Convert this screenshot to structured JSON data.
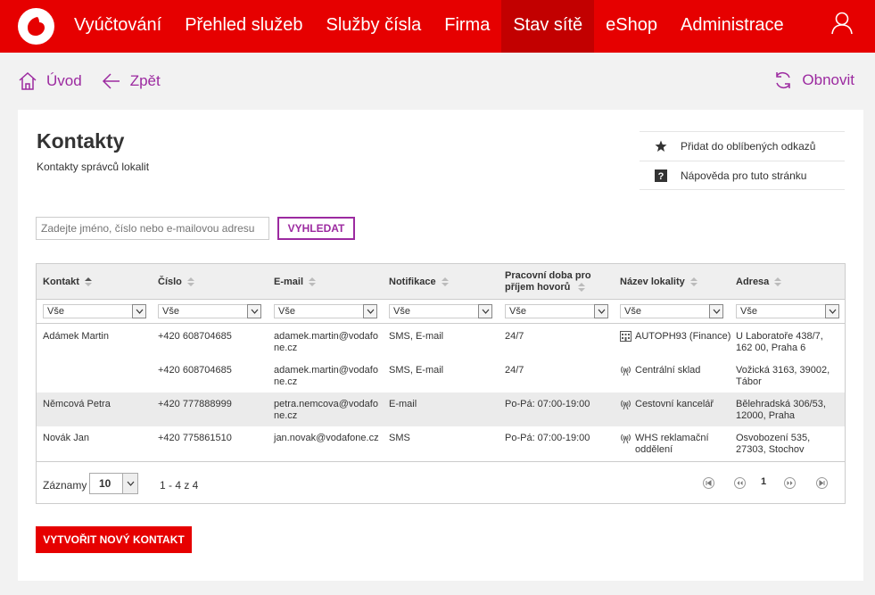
{
  "nav": {
    "items": [
      {
        "label": "Vyúčtování"
      },
      {
        "label": "Přehled služeb"
      },
      {
        "label": "Služby čísla"
      },
      {
        "label": "Firma"
      },
      {
        "label": "Stav sítě",
        "active": true
      },
      {
        "label": "eShop"
      },
      {
        "label": "Administrace"
      }
    ]
  },
  "breadcrumb": {
    "home": "Úvod",
    "back": "Zpět",
    "refresh": "Obnovit"
  },
  "page": {
    "title": "Kontakty",
    "subtitle": "Kontakty správců lokalit"
  },
  "side_links": {
    "favorite": "Přidat do oblíbených odkazů",
    "help": "Nápověda pro tuto stránku"
  },
  "search": {
    "placeholder": "Zadejte jméno, číslo nebo e-mailovou adresu",
    "button": "VYHLEDAT"
  },
  "table": {
    "columns": [
      "Kontakt",
      "Číslo",
      "E-mail",
      "Notifikace",
      "Pracovní doba pro příjem hovorů",
      "Název lokality",
      "Adresa"
    ],
    "filter_value": "Vše",
    "rows": [
      {
        "contact": "Adámek Martin",
        "number": "+420 608704685",
        "email": "adamek.martin@vodafone.cz",
        "notify": "SMS, E-mail",
        "hours": "24/7",
        "location": "AUTOPH93 (Finance)",
        "location_icon": "building-icon",
        "address": "U Laboratoře 438/7, 162 00, Praha 6"
      },
      {
        "contact": "",
        "number": "+420 608704685",
        "email": "adamek.martin@vodafone.cz",
        "notify": "SMS, E-mail",
        "hours": "24/7",
        "location": "Centrální sklad",
        "location_icon": "antenna-icon",
        "address": "Vožická 3163, 39002, Tábor"
      },
      {
        "contact": "Němcová Petra",
        "number": "+420 777888999",
        "email": "petra.nemcova@vodafone.cz",
        "notify": "E-mail",
        "hours": "Po-Pá: 07:00-19:00",
        "location": "Cestovní kancelář",
        "location_icon": "antenna-icon",
        "address": "Bělehradská 306/53, 12000, Praha"
      },
      {
        "contact": "Novák Jan",
        "number": "+420 775861510",
        "email": "jan.novak@vodafone.cz",
        "notify": "SMS",
        "hours": "Po-Pá: 07:00-19:00",
        "location": "WHS reklamační oddělení",
        "location_icon": "antenna-icon",
        "address": "Osvobození 535, 27303, Stochov"
      }
    ]
  },
  "pager": {
    "label": "Záznamy",
    "page_size": "10",
    "count": "1 - 4 z 4",
    "current_page": "1"
  },
  "create_button": "VYTVOŘIT NOVÝ KONTAKT",
  "colors": {
    "brand": "#e60000",
    "accent": "#9c2aa0",
    "nav_active": "#c20000"
  }
}
